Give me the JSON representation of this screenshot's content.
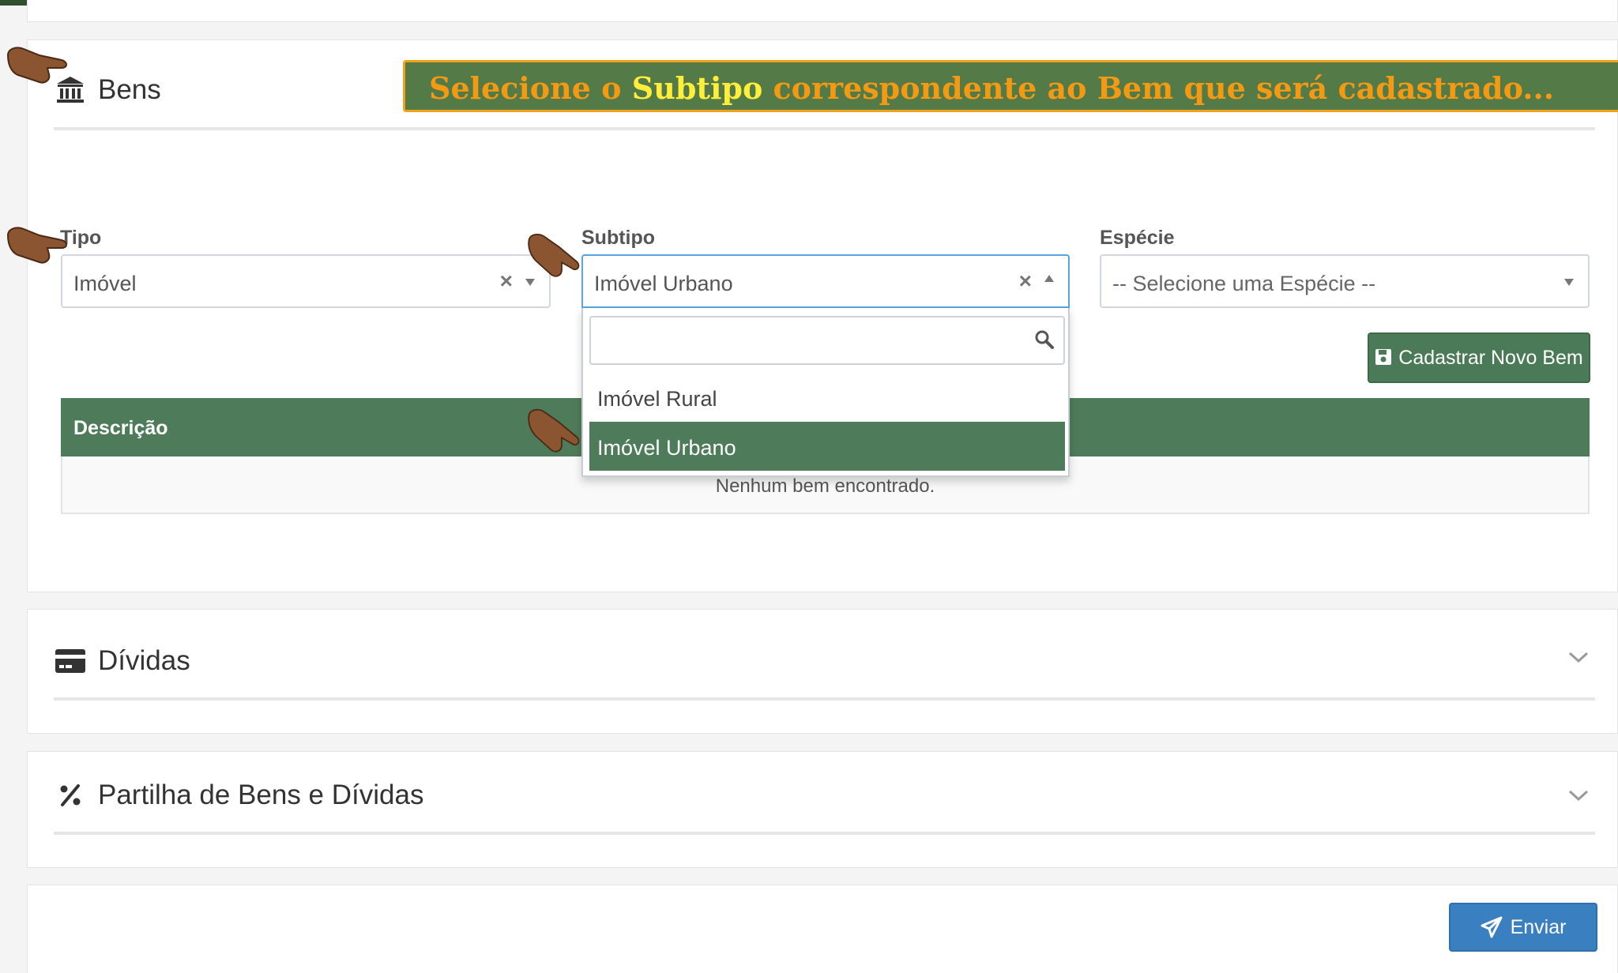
{
  "banner": {
    "before": "Selecione o ",
    "highlight": "Subtipo",
    "after": " correspondente ao Bem que será cadastrado..."
  },
  "bens": {
    "title": "Bens",
    "icon": "bank-icon",
    "fields": {
      "tipo": {
        "label": "Tipo",
        "value": "Imóvel"
      },
      "subtipo": {
        "label": "Subtipo",
        "value": "Imóvel Urbano"
      },
      "especie": {
        "label": "Espécie",
        "placeholder": "-- Selecione uma Espécie --"
      }
    },
    "dropdown": {
      "search_value": "",
      "options": [
        "Imóvel Rural",
        "Imóvel Urbano"
      ],
      "selected": "Imóvel Urbano"
    },
    "cadastrar_button": "Cadastrar Novo Bem",
    "table": {
      "columns": [
        "Descrição"
      ],
      "empty_message": "Nenhum bem encontrado."
    }
  },
  "dividas": {
    "title": "Dívidas",
    "icon": "credit-card-icon"
  },
  "partilha": {
    "title": "Partilha de Bens e Dívidas",
    "icon": "percent-icon"
  },
  "footer": {
    "submit_label": "Enviar",
    "submit_icon": "paper-plane-icon"
  },
  "clear_symbol": "×",
  "colors": {
    "theme_green": "#4e7c5b",
    "banner_bg": "#547a48",
    "banner_text": "#f39a12",
    "banner_highlight": "#ffef3a",
    "banner_border": "#f1a21c",
    "submit_blue": "#3a80c1",
    "focus_border": "#58a4e0"
  }
}
